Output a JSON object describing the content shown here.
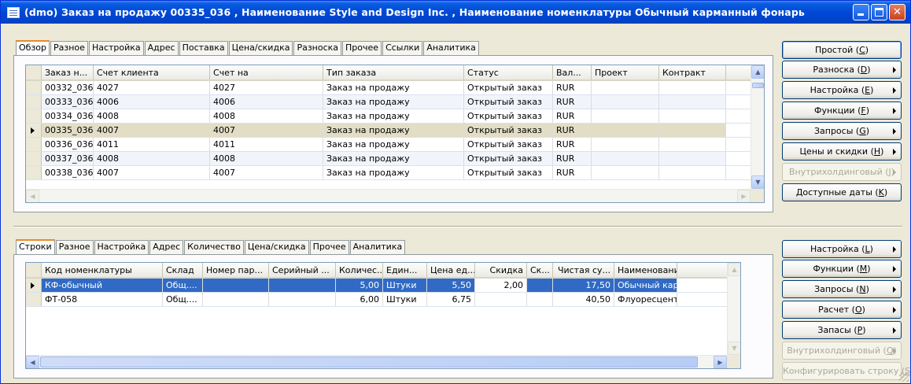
{
  "window": {
    "title": "(dmo) Заказ на продажу 00335_036 , Наименование Style and Design Inc. , Наименование номенклатуры Обычный карманный фонарь"
  },
  "top_tabs": [
    "Обзор",
    "Разное",
    "Настройка",
    "Адрес",
    "Поставка",
    "Цена/скидка",
    "Разноска",
    "Прочее",
    "Ссылки",
    "Аналитика"
  ],
  "top_grid": {
    "columns": [
      "Заказ н...",
      "Счет клиента",
      "Счет на",
      "Тип заказа",
      "Статус",
      "Вал...",
      "Проект",
      "Контракт"
    ],
    "rows": [
      [
        "00332_036",
        "4027",
        "4027",
        "Заказ на продажу",
        "Открытый заказ",
        "RUR",
        "",
        ""
      ],
      [
        "00333_036",
        "4006",
        "4006",
        "Заказ на продажу",
        "Открытый заказ",
        "RUR",
        "",
        ""
      ],
      [
        "00334_036",
        "4008",
        "4008",
        "Заказ на продажу",
        "Открытый заказ",
        "RUR",
        "",
        ""
      ],
      [
        "00335_036",
        "4007",
        "4007",
        "Заказ на продажу",
        "Открытый заказ",
        "RUR",
        "",
        ""
      ],
      [
        "00336_036",
        "4011",
        "4011",
        "Заказ на продажу",
        "Открытый заказ",
        "RUR",
        "",
        ""
      ],
      [
        "00337_036",
        "4008",
        "4008",
        "Заказ на продажу",
        "Открытый заказ",
        "RUR",
        "",
        ""
      ],
      [
        "00338_036",
        "4007",
        "4007",
        "Заказ на продажу",
        "Открытый заказ",
        "RUR",
        "",
        ""
      ]
    ]
  },
  "top_buttons": [
    {
      "text": "Простой",
      "key": "C",
      "submenu": false,
      "enabled": true
    },
    {
      "text": "Разноска",
      "key": "D",
      "submenu": true,
      "enabled": true
    },
    {
      "text": "Настройка",
      "key": "E",
      "submenu": true,
      "enabled": true
    },
    {
      "text": "Функции",
      "key": "F",
      "submenu": true,
      "enabled": true
    },
    {
      "text": "Запросы",
      "key": "G",
      "submenu": true,
      "enabled": true
    },
    {
      "text": "Цены и скидки",
      "key": "H",
      "submenu": true,
      "enabled": true
    },
    {
      "text": "Внутрихолдинговый",
      "key": "J",
      "submenu": true,
      "enabled": false
    },
    {
      "text": "Доступные даты",
      "key": "K",
      "submenu": false,
      "enabled": true
    }
  ],
  "bottom_tabs": [
    "Строки",
    "Разное",
    "Настройка",
    "Адрес",
    "Количество",
    "Цена/скидка",
    "Прочее",
    "Аналитика"
  ],
  "bottom_grid": {
    "columns": [
      "Код номенклатуры",
      "Склад",
      "Номер пар...",
      "Серийный ...",
      "Количес...",
      "Един...",
      "Цена ед...",
      "Скидка",
      "Ск...",
      "Чистая су...",
      "Наименование н"
    ],
    "rows": [
      [
        "КФ-обычный",
        "Общ....",
        "",
        "",
        "5,00",
        "Штуки",
        "5,50",
        "2,00",
        "",
        "17,50",
        "Обычный карма"
      ],
      [
        "ФТ-058",
        "Общ....",
        "",
        "",
        "6,00",
        "Штуки",
        "6,75",
        "",
        "",
        "40,50",
        "Флуоресцентна"
      ]
    ]
  },
  "bottom_buttons": [
    {
      "text": "Настройка",
      "key": "L",
      "submenu": true,
      "enabled": true
    },
    {
      "text": "Функции",
      "key": "M",
      "submenu": true,
      "enabled": true
    },
    {
      "text": "Запросы",
      "key": "N",
      "submenu": true,
      "enabled": true
    },
    {
      "text": "Расчет",
      "key": "O",
      "submenu": true,
      "enabled": true
    },
    {
      "text": "Запасы",
      "key": "P",
      "submenu": true,
      "enabled": true
    },
    {
      "text": "Внутрихолдинговый",
      "key": "Q",
      "submenu": true,
      "enabled": false
    },
    {
      "text": "Конфигурировать строку",
      "key": "S",
      "submenu": false,
      "enabled": false
    }
  ],
  "colors": {
    "titlebar": "#0048d6",
    "selection": "#316ac5",
    "current_row": "#e2ddc5",
    "tab_active_accent": "#e68b2c"
  },
  "icons": {
    "app": "form-icon",
    "minimize": "minimize-icon",
    "maximize": "maximize-icon",
    "close": "close-icon"
  }
}
